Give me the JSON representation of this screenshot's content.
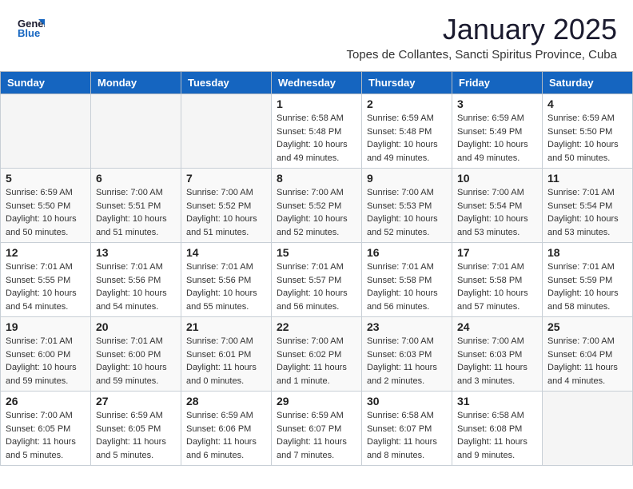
{
  "header": {
    "logo_general": "General",
    "logo_blue": "Blue",
    "month_title": "January 2025",
    "subtitle": "Topes de Collantes, Sancti Spiritus Province, Cuba"
  },
  "weekdays": [
    "Sunday",
    "Monday",
    "Tuesday",
    "Wednesday",
    "Thursday",
    "Friday",
    "Saturday"
  ],
  "weeks": [
    [
      {
        "day": "",
        "info": ""
      },
      {
        "day": "",
        "info": ""
      },
      {
        "day": "",
        "info": ""
      },
      {
        "day": "1",
        "info": "Sunrise: 6:58 AM\nSunset: 5:48 PM\nDaylight: 10 hours\nand 49 minutes."
      },
      {
        "day": "2",
        "info": "Sunrise: 6:59 AM\nSunset: 5:48 PM\nDaylight: 10 hours\nand 49 minutes."
      },
      {
        "day": "3",
        "info": "Sunrise: 6:59 AM\nSunset: 5:49 PM\nDaylight: 10 hours\nand 49 minutes."
      },
      {
        "day": "4",
        "info": "Sunrise: 6:59 AM\nSunset: 5:50 PM\nDaylight: 10 hours\nand 50 minutes."
      }
    ],
    [
      {
        "day": "5",
        "info": "Sunrise: 6:59 AM\nSunset: 5:50 PM\nDaylight: 10 hours\nand 50 minutes."
      },
      {
        "day": "6",
        "info": "Sunrise: 7:00 AM\nSunset: 5:51 PM\nDaylight: 10 hours\nand 51 minutes."
      },
      {
        "day": "7",
        "info": "Sunrise: 7:00 AM\nSunset: 5:52 PM\nDaylight: 10 hours\nand 51 minutes."
      },
      {
        "day": "8",
        "info": "Sunrise: 7:00 AM\nSunset: 5:52 PM\nDaylight: 10 hours\nand 52 minutes."
      },
      {
        "day": "9",
        "info": "Sunrise: 7:00 AM\nSunset: 5:53 PM\nDaylight: 10 hours\nand 52 minutes."
      },
      {
        "day": "10",
        "info": "Sunrise: 7:00 AM\nSunset: 5:54 PM\nDaylight: 10 hours\nand 53 minutes."
      },
      {
        "day": "11",
        "info": "Sunrise: 7:01 AM\nSunset: 5:54 PM\nDaylight: 10 hours\nand 53 minutes."
      }
    ],
    [
      {
        "day": "12",
        "info": "Sunrise: 7:01 AM\nSunset: 5:55 PM\nDaylight: 10 hours\nand 54 minutes."
      },
      {
        "day": "13",
        "info": "Sunrise: 7:01 AM\nSunset: 5:56 PM\nDaylight: 10 hours\nand 54 minutes."
      },
      {
        "day": "14",
        "info": "Sunrise: 7:01 AM\nSunset: 5:56 PM\nDaylight: 10 hours\nand 55 minutes."
      },
      {
        "day": "15",
        "info": "Sunrise: 7:01 AM\nSunset: 5:57 PM\nDaylight: 10 hours\nand 56 minutes."
      },
      {
        "day": "16",
        "info": "Sunrise: 7:01 AM\nSunset: 5:58 PM\nDaylight: 10 hours\nand 56 minutes."
      },
      {
        "day": "17",
        "info": "Sunrise: 7:01 AM\nSunset: 5:58 PM\nDaylight: 10 hours\nand 57 minutes."
      },
      {
        "day": "18",
        "info": "Sunrise: 7:01 AM\nSunset: 5:59 PM\nDaylight: 10 hours\nand 58 minutes."
      }
    ],
    [
      {
        "day": "19",
        "info": "Sunrise: 7:01 AM\nSunset: 6:00 PM\nDaylight: 10 hours\nand 59 minutes."
      },
      {
        "day": "20",
        "info": "Sunrise: 7:01 AM\nSunset: 6:00 PM\nDaylight: 10 hours\nand 59 minutes."
      },
      {
        "day": "21",
        "info": "Sunrise: 7:00 AM\nSunset: 6:01 PM\nDaylight: 11 hours\nand 0 minutes."
      },
      {
        "day": "22",
        "info": "Sunrise: 7:00 AM\nSunset: 6:02 PM\nDaylight: 11 hours\nand 1 minute."
      },
      {
        "day": "23",
        "info": "Sunrise: 7:00 AM\nSunset: 6:03 PM\nDaylight: 11 hours\nand 2 minutes."
      },
      {
        "day": "24",
        "info": "Sunrise: 7:00 AM\nSunset: 6:03 PM\nDaylight: 11 hours\nand 3 minutes."
      },
      {
        "day": "25",
        "info": "Sunrise: 7:00 AM\nSunset: 6:04 PM\nDaylight: 11 hours\nand 4 minutes."
      }
    ],
    [
      {
        "day": "26",
        "info": "Sunrise: 7:00 AM\nSunset: 6:05 PM\nDaylight: 11 hours\nand 5 minutes."
      },
      {
        "day": "27",
        "info": "Sunrise: 6:59 AM\nSunset: 6:05 PM\nDaylight: 11 hours\nand 5 minutes."
      },
      {
        "day": "28",
        "info": "Sunrise: 6:59 AM\nSunset: 6:06 PM\nDaylight: 11 hours\nand 6 minutes."
      },
      {
        "day": "29",
        "info": "Sunrise: 6:59 AM\nSunset: 6:07 PM\nDaylight: 11 hours\nand 7 minutes."
      },
      {
        "day": "30",
        "info": "Sunrise: 6:58 AM\nSunset: 6:07 PM\nDaylight: 11 hours\nand 8 minutes."
      },
      {
        "day": "31",
        "info": "Sunrise: 6:58 AM\nSunset: 6:08 PM\nDaylight: 11 hours\nand 9 minutes."
      },
      {
        "day": "",
        "info": ""
      }
    ]
  ]
}
